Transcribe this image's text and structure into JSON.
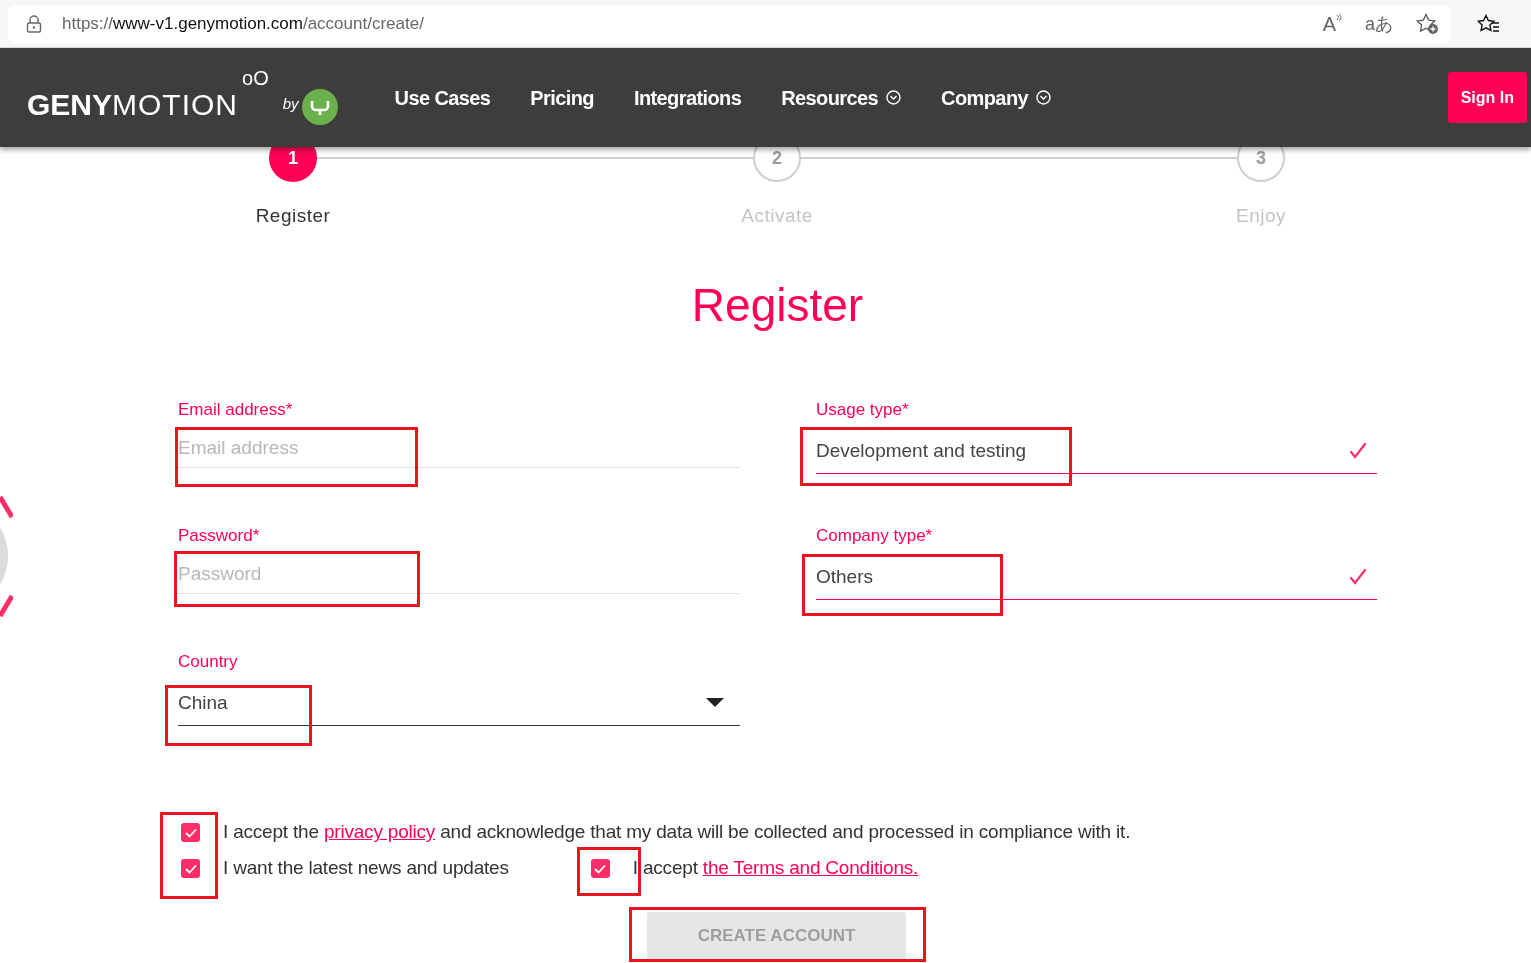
{
  "browser": {
    "url": {
      "scheme": "https://",
      "host": "www-v1.genymotion.com",
      "path": "/account/create/"
    },
    "read_aloud_glyph": "A",
    "translate_glyph": "aあ"
  },
  "navbar": {
    "logo": {
      "bold": "GENY",
      "light": "MOTION",
      "mark": "oO",
      "by": "by"
    },
    "items": [
      {
        "label": "Use Cases",
        "has_dropdown": false
      },
      {
        "label": "Pricing",
        "has_dropdown": false
      },
      {
        "label": "Integrations",
        "has_dropdown": false
      },
      {
        "label": "Resources",
        "has_dropdown": true
      },
      {
        "label": "Company",
        "has_dropdown": true
      }
    ],
    "sign_in": "Sign In"
  },
  "steps": [
    {
      "number": "1",
      "label": "Register",
      "selected": true
    },
    {
      "number": "2",
      "label": "Activate",
      "selected": false
    },
    {
      "number": "3",
      "label": "Enjoy",
      "selected": false
    }
  ],
  "heading": "Register",
  "left_fields": [
    {
      "kind": "text",
      "label": "Email address*",
      "placeholder": "Email address",
      "valid": false
    },
    {
      "kind": "password",
      "label": "Password*",
      "placeholder": "Password",
      "valid": false
    },
    {
      "kind": "dropdown",
      "label": "Country",
      "value": "China",
      "valid": false
    }
  ],
  "right_fields": [
    {
      "kind": "select",
      "label": "Usage type*",
      "value": "Development and testing",
      "valid": true
    },
    {
      "kind": "select",
      "label": "Company type*",
      "value": "Others",
      "valid": true
    }
  ],
  "consents": [
    [
      {
        "before": "I accept the ",
        "link": "privacy policy",
        "after": " and acknowledge that my data will be collected and processed in compliance with it.",
        "checked": true
      }
    ],
    [
      {
        "before": "I want the latest news and updates",
        "checked": true
      },
      {
        "before": "I accept ",
        "link": "the Terms and Conditions.",
        "checked": true
      }
    ]
  ],
  "submit": {
    "label": "CREATE ACCOUNT",
    "disabled": true
  }
}
